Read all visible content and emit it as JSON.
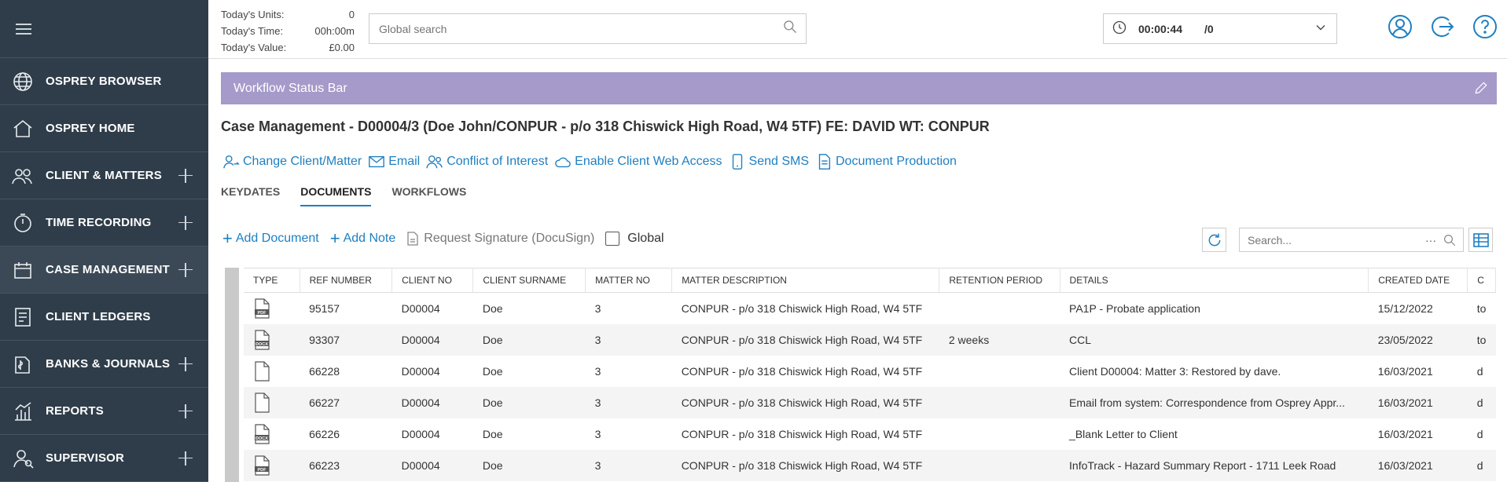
{
  "stats": {
    "units_label": "Today's Units:",
    "units_value": "0",
    "time_label": "Today's Time:",
    "time_value": "00h:00m",
    "value_label": "Today's Value:",
    "value_value": "£0.00"
  },
  "global_search": {
    "placeholder": "Global search"
  },
  "timer": {
    "time": "00:00:44",
    "counter": "/0"
  },
  "sidebar": {
    "items": [
      {
        "label": "OSPREY BROWSER",
        "icon": "globe-icon",
        "expandable": false
      },
      {
        "label": "OSPREY HOME",
        "icon": "home-icon",
        "expandable": false
      },
      {
        "label": "CLIENT & MATTERS",
        "icon": "users-icon",
        "expandable": true
      },
      {
        "label": "TIME RECORDING",
        "icon": "stopwatch-icon",
        "expandable": true
      },
      {
        "label": "CASE MANAGEMENT",
        "icon": "calendar-icon",
        "expandable": true,
        "active": true
      },
      {
        "label": "CLIENT LEDGERS",
        "icon": "ledger-icon",
        "expandable": false
      },
      {
        "label": "BANKS & JOURNALS",
        "icon": "bank-icon",
        "expandable": true
      },
      {
        "label": "REPORTS",
        "icon": "chart-icon",
        "expandable": true
      },
      {
        "label": "SUPERVISOR",
        "icon": "supervisor-icon",
        "expandable": true
      }
    ]
  },
  "workflow": {
    "label": "Workflow Status Bar"
  },
  "case": {
    "title": "Case Management - D00004/3 (Doe  John/CONPUR - p/o 318 Chiswick High Road, W4 5TF) FE: DAVID WT: CONPUR"
  },
  "actions": {
    "change_client": "Change Client/Matter",
    "email": "Email",
    "conflict": "Conflict of Interest",
    "web_access": "Enable Client Web Access",
    "sms": "Send SMS",
    "doc_production": "Document Production"
  },
  "tabs": [
    "KEYDATES",
    "DOCUMENTS",
    "WORKFLOWS"
  ],
  "toolbar": {
    "add_document": "Add Document",
    "add_note": "Add Note",
    "request_signature": "Request Signature (DocuSign)",
    "global": "Global",
    "search_placeholder": "Search...",
    "search_dots": "···"
  },
  "table": {
    "columns": [
      "TYPE",
      "REF NUMBER",
      "CLIENT NO",
      "CLIENT SURNAME",
      "MATTER NO",
      "MATTER DESCRIPTION",
      "RETENTION PERIOD",
      "DETAILS",
      "CREATED DATE",
      "C"
    ],
    "rows": [
      {
        "type": "PDF",
        "ref": "95157",
        "client_no": "D00004",
        "surname": "Doe",
        "matter_no": "3",
        "description": "CONPUR - p/o 318 Chiswick High Road, W4 5TF",
        "retention": "",
        "details": "PA1P - Probate application",
        "created": "15/12/2022",
        "extra": "to"
      },
      {
        "type": "DOCX",
        "ref": "93307",
        "client_no": "D00004",
        "surname": "Doe",
        "matter_no": "3",
        "description": "CONPUR - p/o 318 Chiswick High Road, W4 5TF",
        "retention": "2 weeks",
        "details": "CCL",
        "created": "23/05/2022",
        "extra": "to"
      },
      {
        "type": "",
        "ref": "66228",
        "client_no": "D00004",
        "surname": "Doe",
        "matter_no": "3",
        "description": "CONPUR - p/o 318 Chiswick High Road, W4 5TF",
        "retention": "",
        "details": "Client D00004: Matter 3: Restored by dave.",
        "created": "16/03/2021",
        "extra": "d"
      },
      {
        "type": "",
        "ref": "66227",
        "client_no": "D00004",
        "surname": "Doe",
        "matter_no": "3",
        "description": "CONPUR - p/o 318 Chiswick High Road, W4 5TF",
        "retention": "",
        "details": "Email from system: Correspondence from Osprey Appr...",
        "created": "16/03/2021",
        "extra": "d"
      },
      {
        "type": "DOCX",
        "ref": "66226",
        "client_no": "D00004",
        "surname": "Doe",
        "matter_no": "3",
        "description": "CONPUR - p/o 318 Chiswick High Road, W4 5TF",
        "retention": "",
        "details": "_Blank Letter to Client",
        "created": "16/03/2021",
        "extra": "d"
      },
      {
        "type": "PDF",
        "ref": "66223",
        "client_no": "D00004",
        "surname": "Doe",
        "matter_no": "3",
        "description": "CONPUR - p/o 318 Chiswick High Road, W4 5TF",
        "retention": "",
        "details": "InfoTrack - Hazard Summary Report - 1711 Leek Road",
        "created": "16/03/2021",
        "extra": "d"
      }
    ]
  },
  "colors": {
    "sidebar": "#2f3d4a",
    "accent": "#1f7fc1",
    "workflow": "#a59ac9"
  }
}
